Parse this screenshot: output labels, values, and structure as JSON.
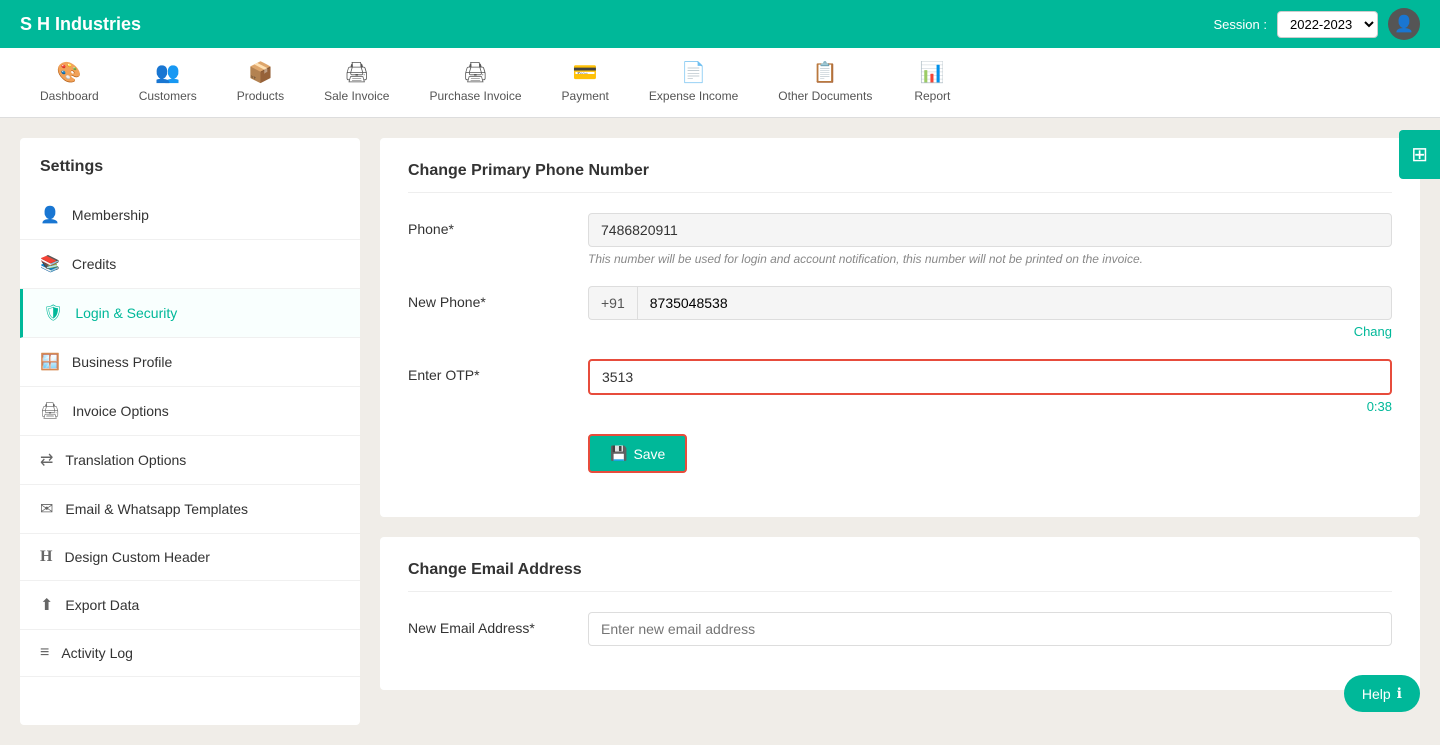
{
  "brand": "S H Industries",
  "session": {
    "label": "Session :",
    "value": "2022-2023"
  },
  "nav": {
    "items": [
      {
        "id": "dashboard",
        "label": "Dashboard",
        "icon": "🎨"
      },
      {
        "id": "customers",
        "label": "Customers",
        "icon": "👥"
      },
      {
        "id": "products",
        "label": "Products",
        "icon": "📦"
      },
      {
        "id": "sale-invoice",
        "label": "Sale Invoice",
        "icon": "🖨"
      },
      {
        "id": "purchase-invoice",
        "label": "Purchase Invoice",
        "icon": "🖨"
      },
      {
        "id": "payment",
        "label": "Payment",
        "icon": "💳"
      },
      {
        "id": "expense-income",
        "label": "Expense Income",
        "icon": "📄"
      },
      {
        "id": "other-documents",
        "label": "Other Documents",
        "icon": "📋"
      },
      {
        "id": "report",
        "label": "Report",
        "icon": "📊"
      }
    ]
  },
  "sidebar": {
    "title": "Settings",
    "items": [
      {
        "id": "membership",
        "label": "Membership",
        "icon": "👤"
      },
      {
        "id": "credits",
        "label": "Credits",
        "icon": "📚"
      },
      {
        "id": "login-security",
        "label": "Login & Security",
        "icon": "🛡",
        "active": true
      },
      {
        "id": "business-profile",
        "label": "Business Profile",
        "icon": "🪟"
      },
      {
        "id": "invoice-options",
        "label": "Invoice Options",
        "icon": "🖨"
      },
      {
        "id": "translation-options",
        "label": "Translation Options",
        "icon": "⇄"
      },
      {
        "id": "email-whatsapp",
        "label": "Email & Whatsapp Templates",
        "icon": "✉"
      },
      {
        "id": "design-header",
        "label": "Design Custom Header",
        "icon": "H"
      },
      {
        "id": "export-data",
        "label": "Export Data",
        "icon": "⬆"
      },
      {
        "id": "activity-log",
        "label": "Activity Log",
        "icon": "≡"
      }
    ]
  },
  "phone_section": {
    "title": "Change Primary Phone Number",
    "phone_label": "Phone*",
    "phone_value": "7486820911",
    "phone_hint": "This number will be used for login and account notification, this number will not be printed on the invoice.",
    "new_phone_label": "New Phone*",
    "new_phone_prefix": "+91",
    "new_phone_value": "8735048538",
    "change_link": "Chang",
    "otp_label": "Enter OTP*",
    "otp_value": "3513",
    "otp_timer": "0:38",
    "save_label": "Save"
  },
  "email_section": {
    "title": "Change Email Address",
    "email_label": "New Email Address*",
    "email_placeholder": "Enter new email address"
  },
  "calc_icon": "⊞",
  "help_label": "Help"
}
